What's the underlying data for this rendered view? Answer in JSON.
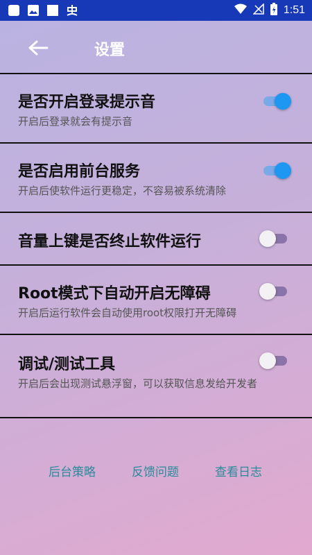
{
  "status_bar": {
    "time": "1:51",
    "icons": [
      "square-icon",
      "image-icon",
      "square-icon",
      "app-glyph-icon",
      "wifi-icon",
      "no-signal-icon",
      "battery-charging-icon"
    ]
  },
  "toolbar": {
    "back_icon": "arrow-left-icon",
    "title": "设置"
  },
  "settings": [
    {
      "title": "是否开启登录提示音",
      "desc": "开启后登录就会有提示音",
      "enabled": true
    },
    {
      "title": "是否启用前台服务",
      "desc": "开启后使软件运行更稳定，不容易被系统清除",
      "enabled": true
    },
    {
      "title": "音量上键是否终止软件运行",
      "desc": "",
      "enabled": false
    },
    {
      "title": "Root模式下自动开启无障碍",
      "desc": "开启后运行软件会自动使用root权限打开无障碍",
      "enabled": false
    },
    {
      "title": "调试/测试工具",
      "desc": "开启后会出现测试悬浮窗，可以获取信息发给开发者",
      "enabled": false
    }
  ],
  "footer": {
    "links": [
      "后台策略",
      "反馈问题",
      "查看日志"
    ]
  },
  "colors": {
    "status_bar": "#1739b8",
    "toggle_on": "#1e97f3",
    "link": "#2b8a9a"
  }
}
